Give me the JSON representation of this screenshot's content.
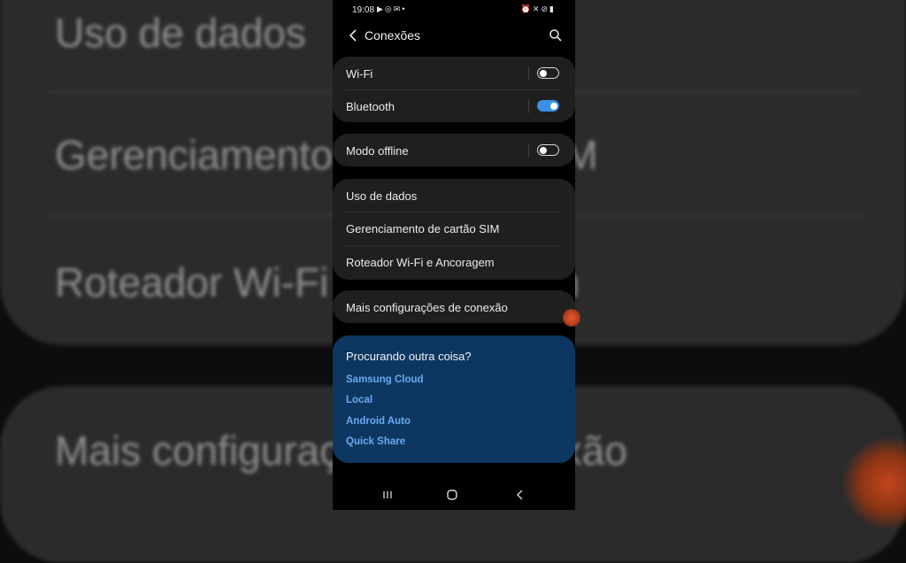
{
  "status_bar": {
    "time": "19:08",
    "left_icons": [
      "youtube-icon",
      "instagram-icon",
      "gmail-icon",
      "dot-icon"
    ],
    "right_icons": [
      "alarm-icon",
      "mute-icon",
      "do-not-disturb-icon",
      "battery-icon"
    ]
  },
  "header": {
    "title": "Conexões"
  },
  "groups": {
    "g1": {
      "wifi": {
        "label": "Wi-Fi",
        "enabled": false
      },
      "bluetooth": {
        "label": "Bluetooth",
        "enabled": true
      }
    },
    "g2": {
      "offline": {
        "label": "Modo offline",
        "enabled": false
      }
    },
    "g3": {
      "data_usage": "Uso de dados",
      "sim_manager": "Gerenciamento de cartão SIM",
      "hotspot": "Roteador Wi-Fi e Ancoragem"
    },
    "g4": {
      "more": "Mais configurações de conexão"
    }
  },
  "suggestions": {
    "title": "Procurando outra coisa?",
    "links": [
      "Samsung Cloud",
      "Local",
      "Android Auto",
      "Quick Share"
    ]
  },
  "background": {
    "lines": [
      "Uso de dados",
      "Gerenciamento de cartão SIM",
      "Roteador Wi-Fi e Ancoragem",
      "Mais configurações de conexão"
    ]
  },
  "colors": {
    "accent": "#3c8fe6",
    "card": "#1f1f1f",
    "suggest_bg": "#0d3761",
    "link": "#6aaaf4"
  }
}
